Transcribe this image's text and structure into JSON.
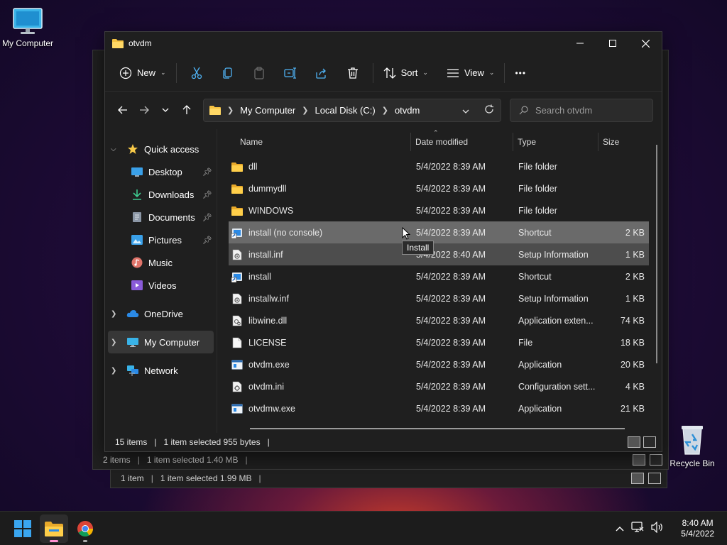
{
  "desktop": {
    "icons": [
      {
        "label": "My Computer"
      },
      {
        "label": "Recycle Bin"
      }
    ]
  },
  "background_windows": [
    {
      "status_items": "2 items",
      "status_selected": "1 item selected  1.40 MB"
    },
    {
      "status_items": "1 item",
      "status_selected": "1 item selected  1.99 MB"
    }
  ],
  "window": {
    "title": "otvdm",
    "toolbar": {
      "new_label": "New",
      "sort_label": "Sort",
      "view_label": "View",
      "more_label": "•••"
    },
    "address": {
      "crumbs": [
        "My Computer",
        "Local Disk (C:)",
        "otvdm"
      ]
    },
    "search": {
      "placeholder": "Search otvdm"
    },
    "nav": {
      "quick_access": "Quick access",
      "items": [
        {
          "label": "Desktop"
        },
        {
          "label": "Downloads"
        },
        {
          "label": "Documents"
        },
        {
          "label": "Pictures"
        },
        {
          "label": "Music"
        },
        {
          "label": "Videos"
        }
      ],
      "onedrive": "OneDrive",
      "my_computer": "My Computer",
      "network": "Network"
    },
    "columns": {
      "name": "Name",
      "date": "Date modified",
      "type": "Type",
      "size": "Size"
    },
    "files": [
      {
        "name": "dll",
        "date": "5/4/2022 8:39 AM",
        "type": "File folder",
        "size": "",
        "icon": "folder"
      },
      {
        "name": "dummydll",
        "date": "5/4/2022 8:39 AM",
        "type": "File folder",
        "size": "",
        "icon": "folder"
      },
      {
        "name": "WINDOWS",
        "date": "5/4/2022 8:39 AM",
        "type": "File folder",
        "size": "",
        "icon": "folder"
      },
      {
        "name": "install (no console)",
        "date": "5/4/2022 8:39 AM",
        "type": "Shortcut",
        "size": "2 KB",
        "icon": "shortcut"
      },
      {
        "name": "install.inf",
        "date": "5/4/2022 8:40 AM",
        "type": "Setup Information",
        "size": "1 KB",
        "icon": "inf"
      },
      {
        "name": "install",
        "date": "5/4/2022 8:39 AM",
        "type": "Shortcut",
        "size": "2 KB",
        "icon": "shortcut"
      },
      {
        "name": "installw.inf",
        "date": "5/4/2022 8:39 AM",
        "type": "Setup Information",
        "size": "1 KB",
        "icon": "inf"
      },
      {
        "name": "libwine.dll",
        "date": "5/4/2022 8:39 AM",
        "type": "Application exten...",
        "size": "74 KB",
        "icon": "dll"
      },
      {
        "name": "LICENSE",
        "date": "5/4/2022 8:39 AM",
        "type": "File",
        "size": "18 KB",
        "icon": "file"
      },
      {
        "name": "otvdm.exe",
        "date": "5/4/2022 8:39 AM",
        "type": "Application",
        "size": "20 KB",
        "icon": "exe"
      },
      {
        "name": "otvdm.ini",
        "date": "5/4/2022 8:39 AM",
        "type": "Configuration sett...",
        "size": "4 KB",
        "icon": "ini"
      },
      {
        "name": "otvdmw.exe",
        "date": "5/4/2022 8:39 AM",
        "type": "Application",
        "size": "21 KB",
        "icon": "exe"
      }
    ],
    "selected_row": 4,
    "hovered_row": 3,
    "tooltip": "Install",
    "status": {
      "items": "15 items",
      "selected": "1 item selected  955 bytes"
    }
  },
  "taskbar": {
    "time": "8:40 AM",
    "date": "5/4/2022"
  }
}
